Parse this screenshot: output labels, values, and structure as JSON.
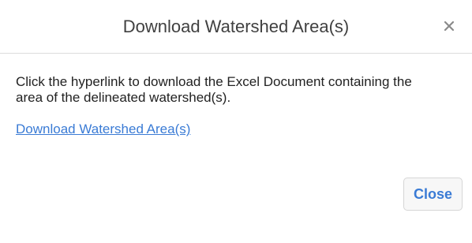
{
  "dialog": {
    "title": "Download Watershed Area(s)",
    "description": "Click the hyperlink to download the Excel Document containing the area of the delineated watershed(s).",
    "link_text": "Download Watershed Area(s)",
    "close_label": "Close",
    "close_icon": "close-icon"
  },
  "colors": {
    "link": "#3a7bd5",
    "title_text": "#404040",
    "divider": "#dcdcdc",
    "close_icon": "#8a8a8a"
  }
}
